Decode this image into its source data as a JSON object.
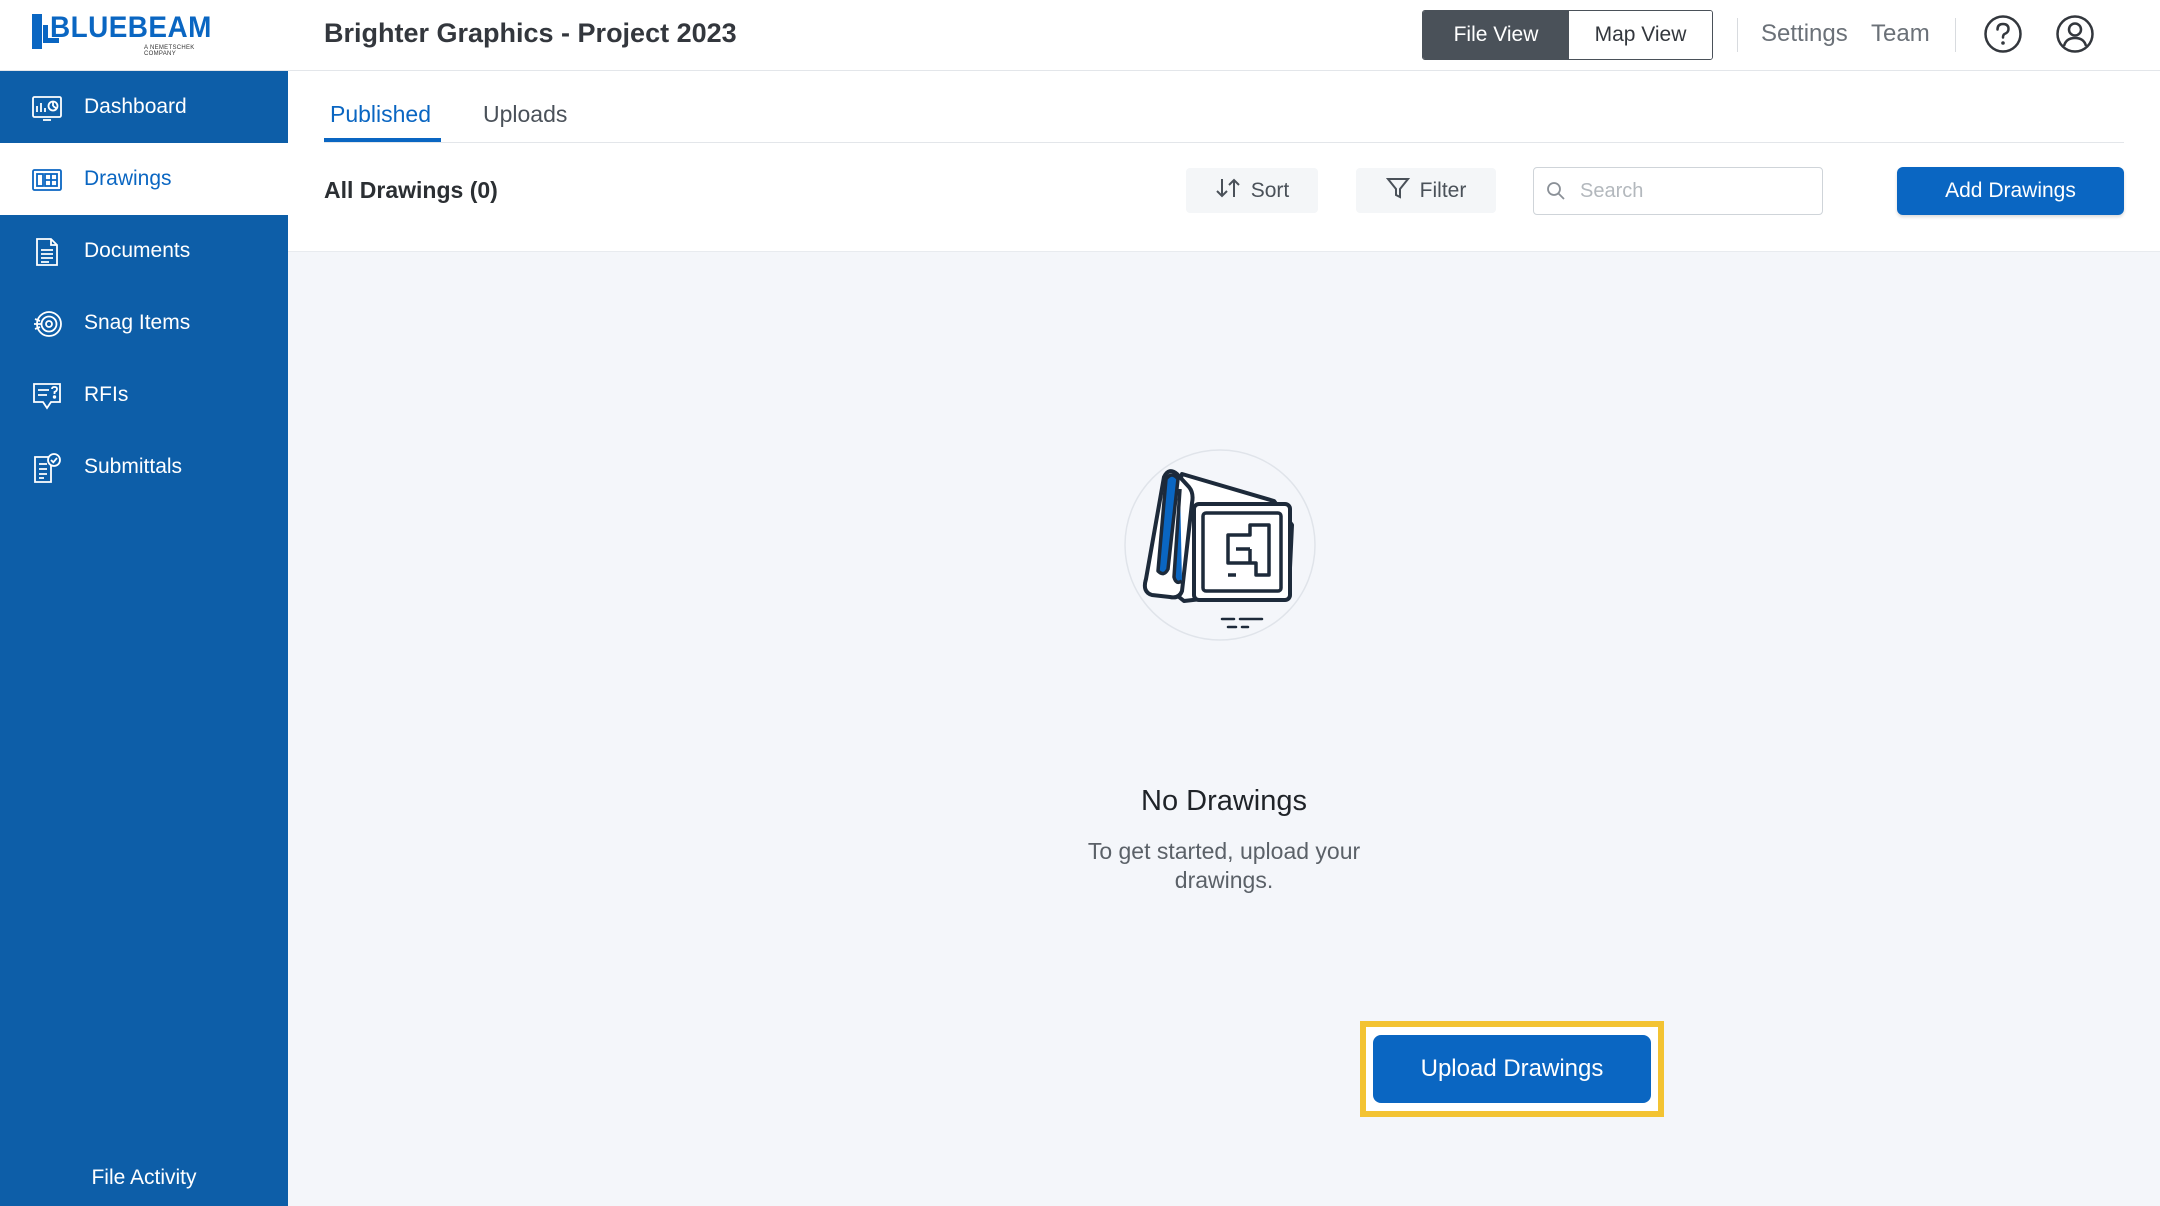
{
  "app": {
    "brand_name": "BLUEBEAM",
    "brand_sub": "A NEMETSCHEK COMPANY",
    "project_title": "Brighter Graphics - Project 2023"
  },
  "header": {
    "view_toggle": {
      "file_view": "File View",
      "map_view": "Map View",
      "active": "file_view"
    },
    "settings": "Settings",
    "team": "Team",
    "icons": [
      "help-icon",
      "account-icon"
    ]
  },
  "sidebar": {
    "items": [
      {
        "label": "Dashboard",
        "icon": "dashboard-icon",
        "active": false
      },
      {
        "label": "Drawings",
        "icon": "drawings-icon",
        "active": true
      },
      {
        "label": "Documents",
        "icon": "documents-icon",
        "active": false
      },
      {
        "label": "Snag Items",
        "icon": "snag-items-icon",
        "active": false
      },
      {
        "label": "RFIs",
        "icon": "rfis-icon",
        "active": false
      },
      {
        "label": "Submittals",
        "icon": "submittals-icon",
        "active": false
      }
    ],
    "footer": "File Activity"
  },
  "main": {
    "tabs": [
      {
        "label": "Published",
        "active": true
      },
      {
        "label": "Uploads",
        "active": false
      }
    ],
    "all_label": "All Drawings (0)",
    "sort_label": "Sort",
    "filter_label": "Filter",
    "search_placeholder": "Search",
    "add_button": "Add Drawings",
    "empty": {
      "title": "No Drawings",
      "subtitle_line1": "To get started, upload your",
      "subtitle_line2": "drawings.",
      "button": "Upload Drawings"
    }
  },
  "colors": {
    "brand_blue": "#0a66c2",
    "sidebar_bg": "#0d5ea8",
    "content_bg": "#f4f6fa",
    "focus_ring": "#f3c332",
    "toggle_active": "#4a5159"
  }
}
